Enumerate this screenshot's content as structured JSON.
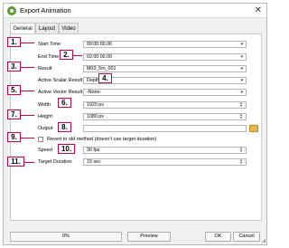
{
  "window": {
    "title": "Export Animation",
    "close_glyph": "✕"
  },
  "tabs": [
    {
      "label": "General",
      "active": true
    },
    {
      "label": "Layout",
      "active": false
    },
    {
      "label": "Video",
      "active": false
    }
  ],
  "form": {
    "start_time": {
      "label": "Start Time",
      "value": "00:00:00.00"
    },
    "end_time": {
      "label": "End Time",
      "value": "02:00:00.00"
    },
    "result": {
      "label": "Result",
      "value": "M03_5m_001"
    },
    "active_scalar": {
      "label": "Active Scalar Result",
      "value": "Depth"
    },
    "active_vector": {
      "label": "Active Vector Result",
      "value": "-None-"
    },
    "width": {
      "label": "Width",
      "value": "1920 px"
    },
    "height": {
      "label": "Height",
      "value": "1080 px"
    },
    "output": {
      "label": "Output",
      "value": ""
    },
    "revert": {
      "label": "Revert to old method (doesn't use target duration)",
      "checked": false
    },
    "speed": {
      "label": "Speed",
      "value": "30 fps"
    },
    "target_duration": {
      "label": "Target Duration",
      "value": "15 sec"
    }
  },
  "glyphs": {
    "combo": "▾",
    "spin_up": "▲",
    "spin_down": "▼"
  },
  "callouts": [
    "1.",
    "2.",
    "3.",
    "4.",
    "5.",
    "6.",
    "7.",
    "8.",
    "9.",
    "10.",
    "11."
  ],
  "footer": {
    "progress": "0%",
    "preview": "Preview",
    "ok": "OK",
    "cancel": "Cancel"
  },
  "colors": {
    "callout": "#cc0044",
    "folder": "#e9b64a",
    "qgis_green": "#5b9b2f"
  },
  "icons": [
    "qgis-logo-icon",
    "close-icon",
    "folder-icon",
    "combo-arrow-icon",
    "spin-icon",
    "resize-grip-icon"
  ]
}
